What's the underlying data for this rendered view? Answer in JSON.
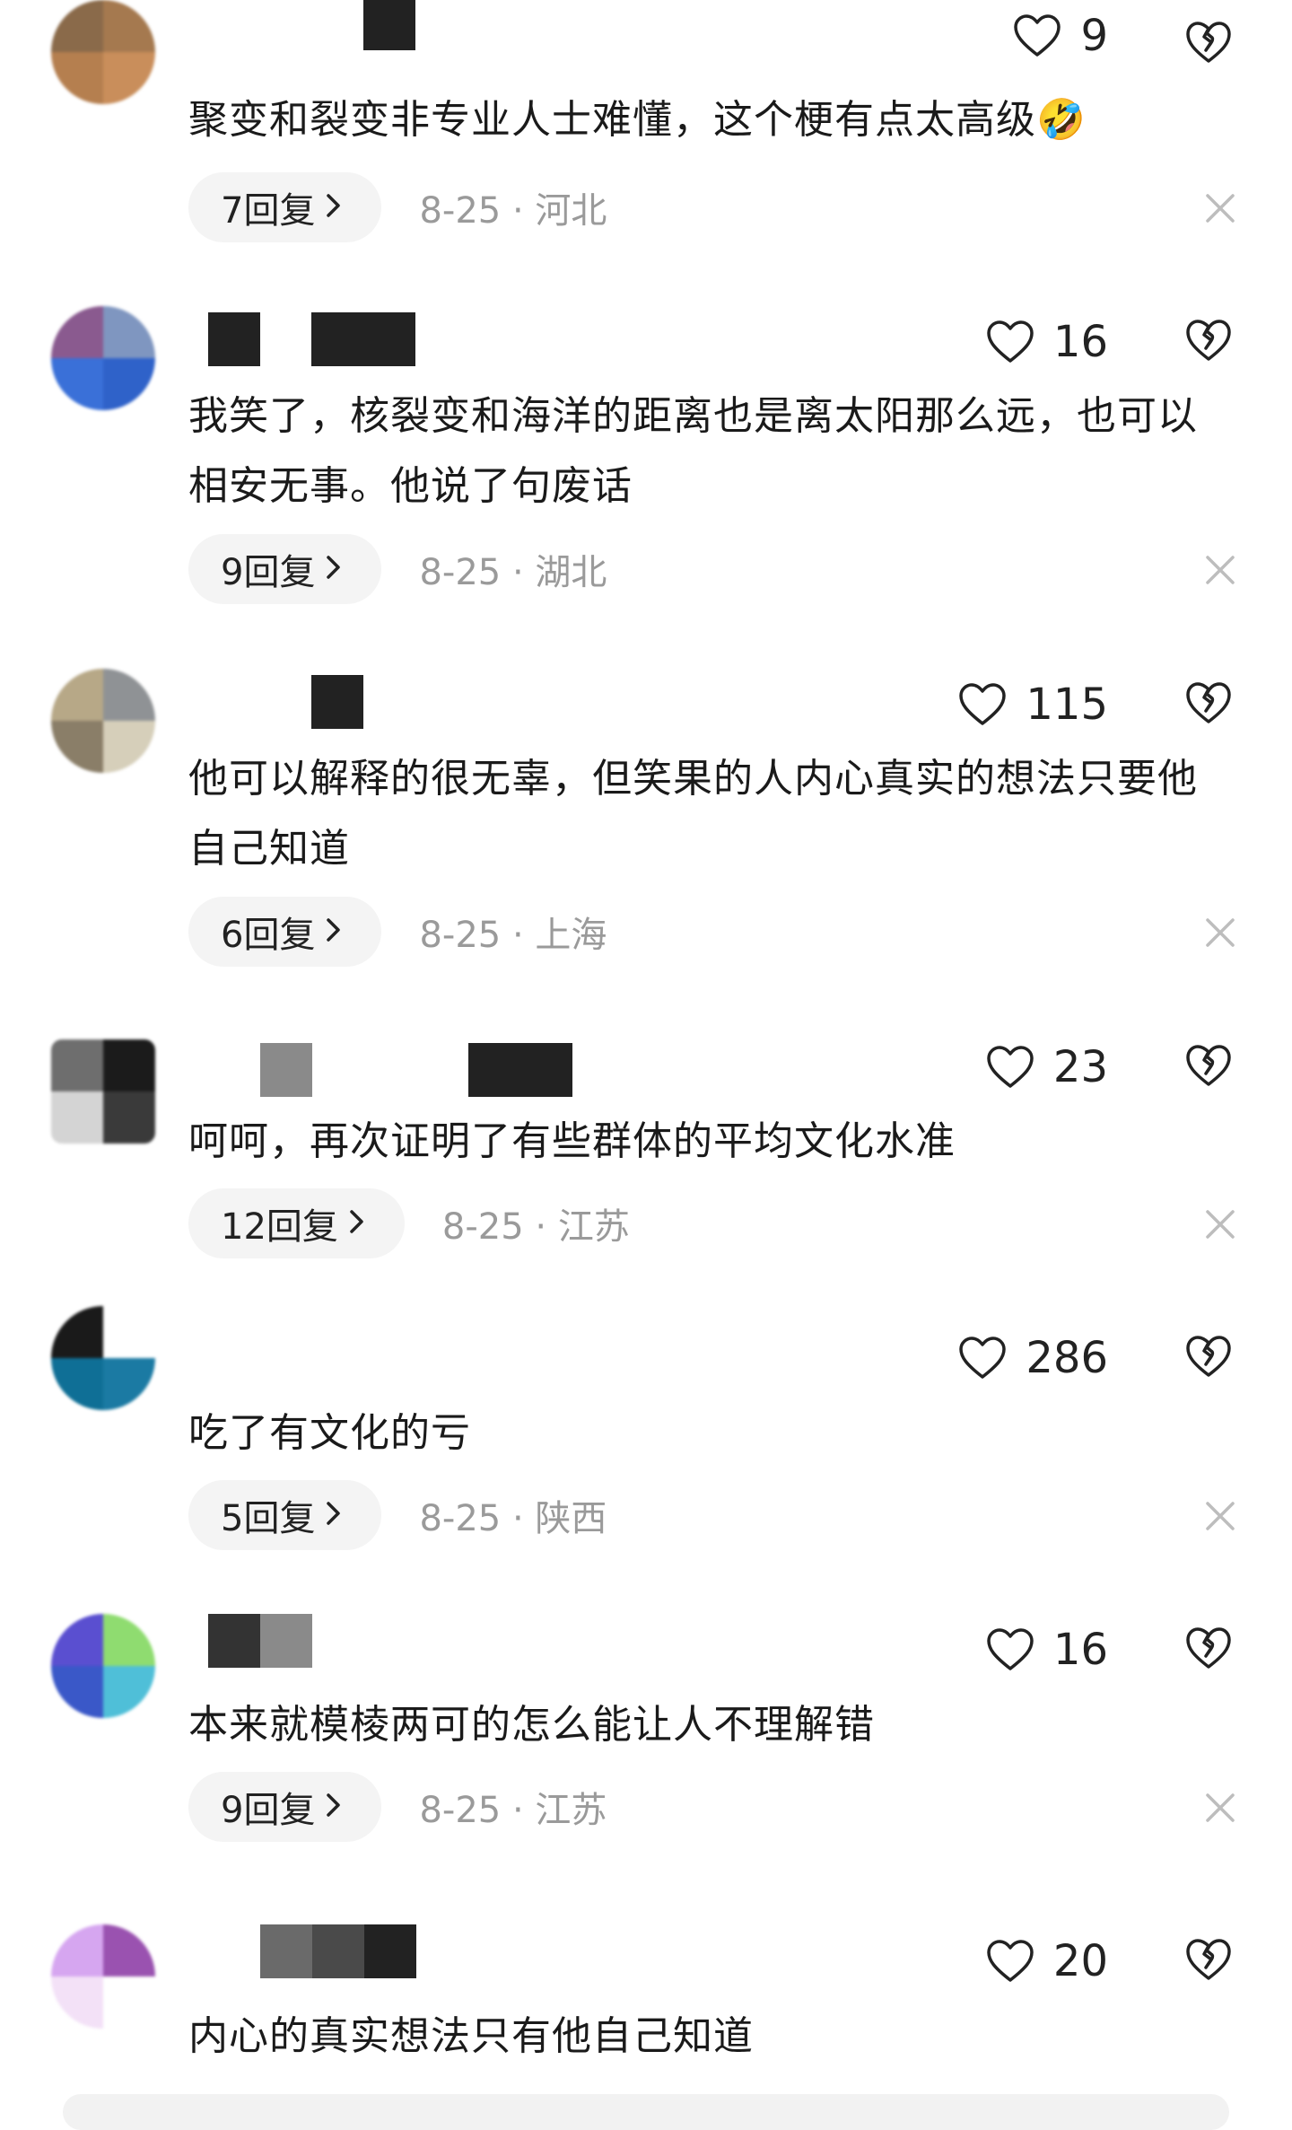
{
  "comments": [
    {
      "likes": "9",
      "text": "聚变和裂变非专业人士难懂，这个梗有点太高级🤣",
      "replies": "7回复",
      "date_loc": "8-25 · 河北",
      "avatar_colors": [
        "#8a6a4a",
        "#a5794f",
        "#b57f4f",
        "#c98e5b"
      ]
    },
    {
      "likes": "16",
      "text": "我笑了，核裂变和海洋的距离也是离太阳那么远，也可以相安无事。他说了句废话",
      "replies": "9回复",
      "date_loc": "8-25 · 湖北",
      "avatar_colors": [
        "#8a5a8f",
        "#7f96c0",
        "#3a70d8",
        "#2f62c9"
      ]
    },
    {
      "likes": "115",
      "text": "他可以解释的很无辜，但笑果的人内心真实的想法只要他自己知道",
      "replies": "6回复",
      "date_loc": "8-25 · 上海",
      "avatar_colors": [
        "#b7a887",
        "#8f9295",
        "#8a7e68",
        "#d6cfba"
      ]
    },
    {
      "likes": "23",
      "text": "呵呵，再次证明了有些群体的平均文化水准",
      "replies": "12回复",
      "date_loc": "8-25 · 江苏",
      "avatar_colors": [
        "#6e6e6e",
        "#1b1b1b",
        "#d4d4d4",
        "#3a3a3a"
      ]
    },
    {
      "likes": "286",
      "text": "吃了有文化的亏",
      "replies": "5回复",
      "date_loc": "8-25 · 陕西",
      "avatar_colors": [
        "#1a1a1a",
        "#ffffff",
        "#0f6f96",
        "#1b7aa3"
      ]
    },
    {
      "likes": "16",
      "text": "本来就模棱两可的怎么能让人不理解错",
      "replies": "9回复",
      "date_loc": "8-25 · 江苏",
      "avatar_colors": [
        "#5a4fd0",
        "#8fdc70",
        "#3a58c8",
        "#4fbfd8"
      ]
    },
    {
      "likes": "20",
      "text": "内心的真实想法只有他自己知道",
      "replies": "",
      "date_loc": "",
      "avatar_colors": [
        "#d6a6f0",
        "#9a52b0",
        "#f3e1f7",
        "#ffffff"
      ]
    }
  ],
  "colors": {
    "text": "#1a1a1a",
    "meta": "#9a9a9a",
    "pill_bg": "#f4f4f4"
  },
  "icons": {
    "like": "heart-outline-icon",
    "dislike": "broken-heart-icon",
    "chevron": "chevron-right-icon",
    "close": "close-icon"
  }
}
